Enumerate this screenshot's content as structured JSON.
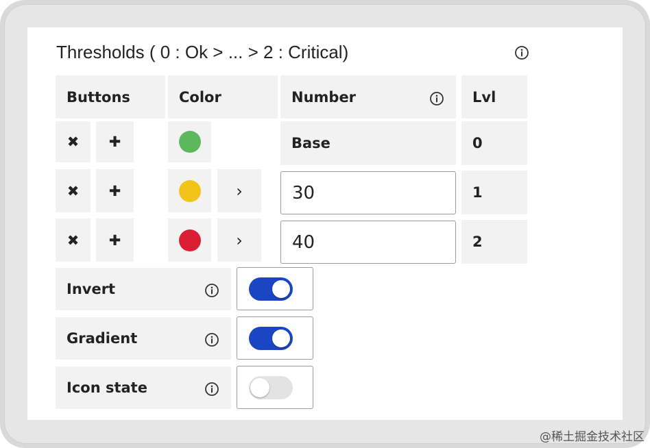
{
  "panel": {
    "title": "Thresholds ( 0 : Ok > ... > 2 : Critical)"
  },
  "table": {
    "headers": {
      "buttons": "Buttons",
      "color": "Color",
      "number": "Number",
      "lvl": "Lvl"
    },
    "base_label": "Base",
    "rows": [
      {
        "color": "#5cb85c",
        "number": "",
        "lvl": "0"
      },
      {
        "color": "#f0c419",
        "number": "30",
        "lvl": "1"
      },
      {
        "color": "#dc1e35",
        "number": "40",
        "lvl": "2"
      }
    ],
    "remove_glyph": "✖",
    "add_glyph": "✚",
    "expand_glyph": "›"
  },
  "options": [
    {
      "label": "Invert",
      "enabled": true
    },
    {
      "label": "Gradient",
      "enabled": true
    },
    {
      "label": "Icon state",
      "enabled": false
    }
  ],
  "colors": {
    "toggle_on": "#1a46c4",
    "toggle_off": "#e3e3e3"
  },
  "watermark": "@稀土掘金技术社区"
}
